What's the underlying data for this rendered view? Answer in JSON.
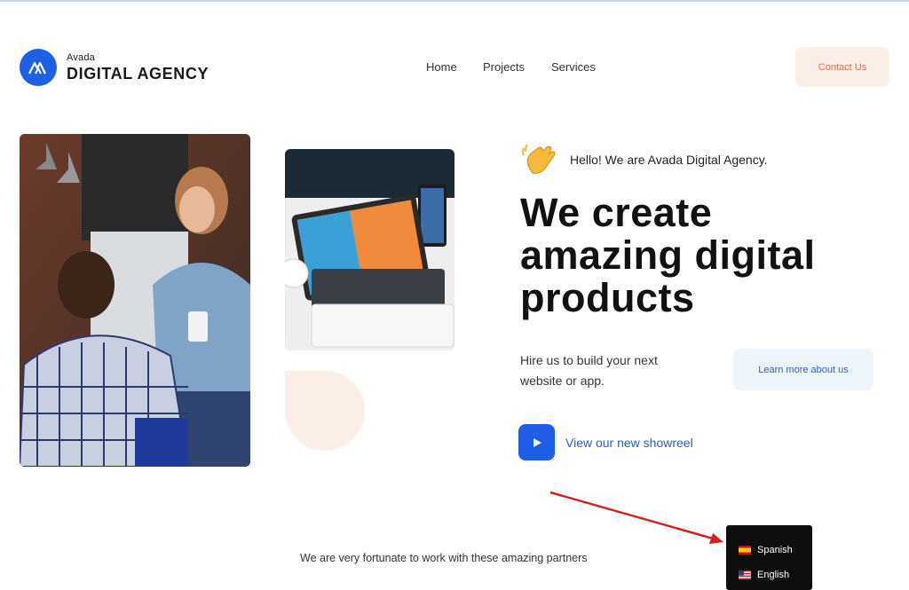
{
  "header": {
    "logo": {
      "small": "Avada",
      "big": "DIGITAL AGENCY",
      "icon": "avada-logo-icon"
    },
    "nav": [
      {
        "label": "Home"
      },
      {
        "label": "Projects"
      },
      {
        "label": "Services"
      }
    ],
    "contact_label": "Contact Us"
  },
  "hero": {
    "greeting_icon": "waving-hand-icon",
    "greeting": "Hello! We are Avada Digital Agency.",
    "headline": [
      "We create",
      "amazing digital",
      "products"
    ],
    "hire_text": "Hire us to build your next website or app.",
    "learn_more_label": "Learn more about us",
    "showreel_icon": "play-icon",
    "showreel_label": "View our new showreel",
    "image_left": "team-working-photo",
    "image_right": "tablet-keyboard-photo"
  },
  "partners_text": "We are very fortunate to work with these amazing partners",
  "language_menu": {
    "items": [
      {
        "label": "Spanish",
        "flag": "spain-flag-icon"
      },
      {
        "label": "English",
        "flag": "us-flag-icon"
      }
    ]
  },
  "colors": {
    "accent_blue": "#1f5fe8",
    "contact_bg": "#fbeee6",
    "contact_text": "#e56d45",
    "link_blue": "#2b5fc0",
    "annotation_red": "#d0211d"
  }
}
